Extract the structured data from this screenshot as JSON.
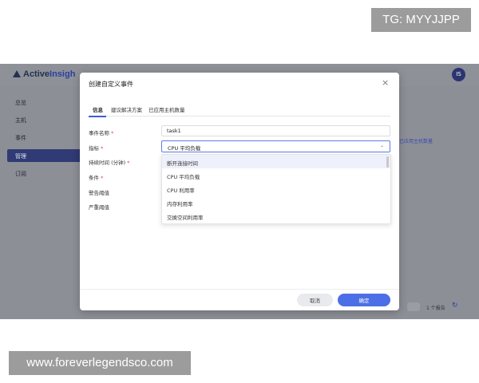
{
  "watermarks": {
    "top": "TG: MYYJJPP",
    "bottom": "www.foreverlegendsco.com"
  },
  "app": {
    "logo_prefix": "Active",
    "logo_highlight": "Insigh",
    "avatar": "IS",
    "sidebar": [
      {
        "label": "总览"
      },
      {
        "label": "主机"
      },
      {
        "label": "事件"
      },
      {
        "label": "管理"
      },
      {
        "label": "订阅"
      }
    ],
    "bg_column_label": "已应用主机数量",
    "bg_pager_text": "1 个报告"
  },
  "modal": {
    "title": "创建自定义事件",
    "close_glyph": "×",
    "tabs": [
      {
        "label": "信息"
      },
      {
        "label": "建议解决方案"
      },
      {
        "label": "已应用主机数量"
      }
    ],
    "fields": {
      "event_name_label": "事件名称",
      "event_name_value": "task1",
      "metric_label": "指标",
      "metric_value": "CPU 平均负载",
      "duration_label": "持续时间 (分钟)",
      "condition_label": "条件",
      "warning_label": "警告阈值",
      "critical_label": "严重阈值",
      "required_mark": "*"
    },
    "dropdown_options": [
      {
        "label": "断开连接时间"
      },
      {
        "label": "CPU 平均负载"
      },
      {
        "label": "CPU 利用率"
      },
      {
        "label": "内存利用率"
      },
      {
        "label": "交换空间利用率"
      }
    ],
    "cancel_label": "取消",
    "ok_label": "确定"
  },
  "colors": {
    "accent": "#4c6ee6",
    "overlay": "#8c8f96",
    "required": "#e03a3a"
  }
}
